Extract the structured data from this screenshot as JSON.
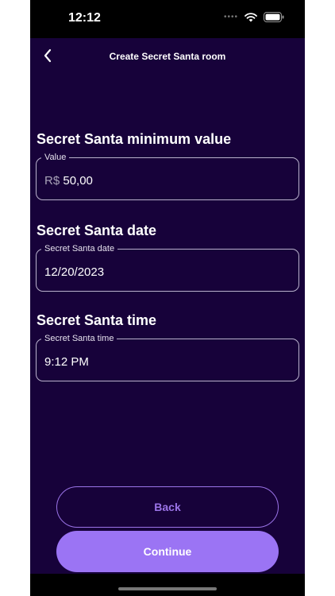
{
  "status": {
    "time": "12:12"
  },
  "header": {
    "title": "Create Secret Santa room"
  },
  "sections": [
    {
      "title": "Secret Santa minimum value",
      "field_label": "Value",
      "prefix": "R$",
      "value": "50,00"
    },
    {
      "title": "Secret Santa date",
      "field_label": "Secret Santa date",
      "value": "12/20/2023"
    },
    {
      "title": "Secret Santa time",
      "field_label": "Secret Santa time",
      "value": "9:12 PM"
    }
  ],
  "buttons": {
    "back": "Back",
    "continue": "Continue"
  },
  "colors": {
    "background": "#17023a",
    "accent": "#9b74f4",
    "field_border": "#b9b2cc"
  },
  "icons": {
    "back": "chevron-left-icon",
    "wifi": "wifi-icon",
    "battery": "battery-icon"
  }
}
